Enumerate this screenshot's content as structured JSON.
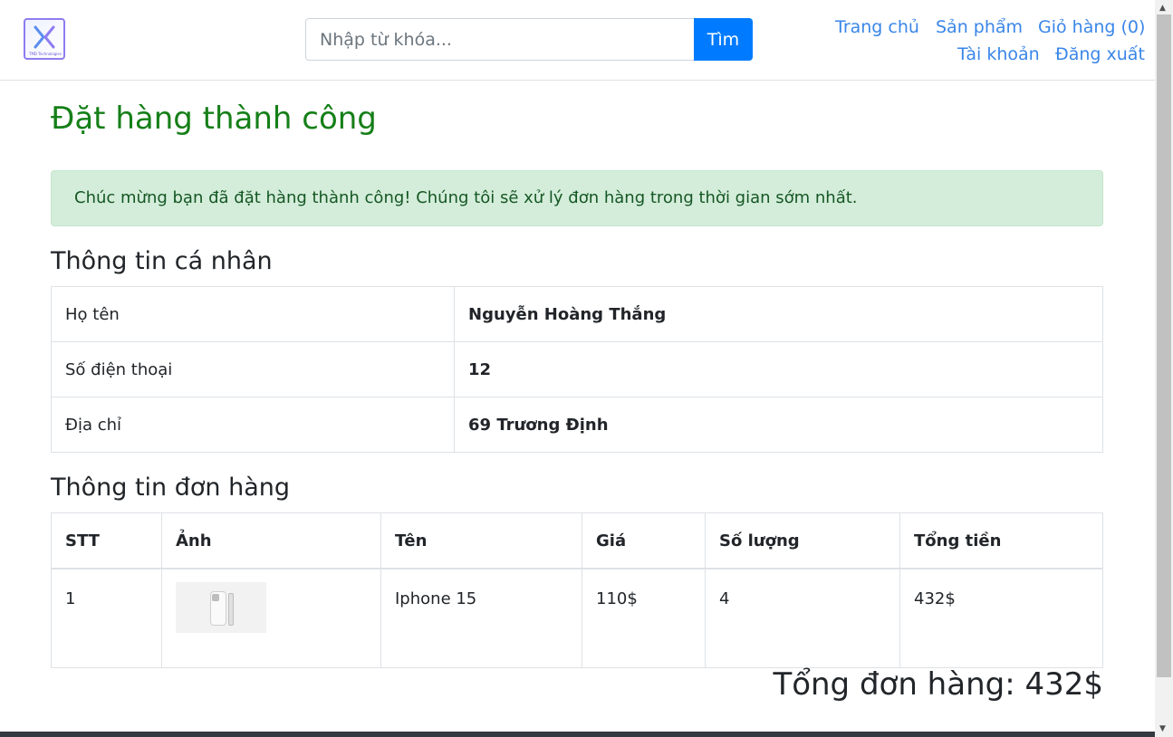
{
  "header": {
    "logo_text": "TMD Technologies",
    "search_placeholder": "Nhập từ khóa...",
    "search_button": "Tìm",
    "nav": {
      "home": "Trang chủ",
      "products": "Sản phẩm",
      "cart": "Giỏ hàng (0)",
      "account": "Tài khoản",
      "logout": "Đăng xuất"
    }
  },
  "main": {
    "title": "Đặt hàng thành công",
    "alert": "Chúc mừng bạn đã đặt hàng thành công! Chúng tôi sẽ xử lý đơn hàng trong thời gian sớm nhất.",
    "personal_heading": "Thông tin cá nhân",
    "personal": [
      {
        "label": "Họ tên",
        "value": "Nguyễn Hoàng Thắng"
      },
      {
        "label": "Số điện thoại",
        "value": "12"
      },
      {
        "label": "Địa chỉ",
        "value": "69 Trương Định"
      }
    ],
    "order_heading": "Thông tin đơn hàng",
    "order_columns": [
      "STT",
      "Ảnh",
      "Tên",
      "Giá",
      "Số lượng",
      "Tổng tiền"
    ],
    "order_rows": [
      {
        "stt": "1",
        "image": "iphone-thumbnail",
        "name": "Iphone 15",
        "price": "110$",
        "quantity": "4",
        "total": "432$"
      }
    ],
    "grand_total": "Tổng đơn hàng: 432$"
  },
  "colors": {
    "primary": "#007bff",
    "success_title": "#157f18",
    "alert_bg": "#d4edda",
    "link": "#3a86e8"
  }
}
